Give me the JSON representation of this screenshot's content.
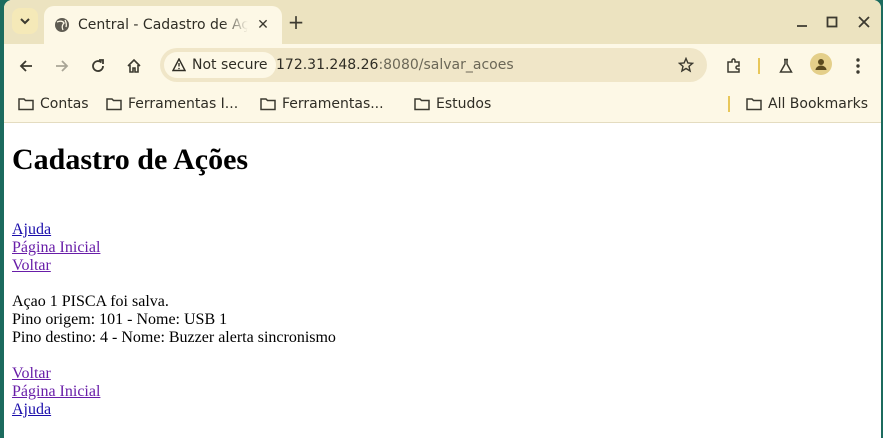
{
  "browser": {
    "tab_title": "Central - Cadastro de Ações",
    "security_label": "Not secure",
    "url_host": "172.31.248.26",
    "url_rest": ":8080/salvar_acoes",
    "bookmarks": [
      "Contas",
      "Ferramentas I...",
      "Ferramentas...",
      "Estudos"
    ],
    "all_bookmarks_label": "All Bookmarks",
    "accent_color": "#ece3c0"
  },
  "page": {
    "title": "Cadastro de Ações",
    "top_links": [
      "Ajuda",
      "Página Inicial",
      "Voltar"
    ],
    "messages": [
      "Açao 1 PISCA foi salva.",
      "Pino origem: 101 - Nome: USB 1",
      "Pino destino: 4 - Nome: Buzzer alerta sincronismo"
    ],
    "bottom_links": [
      "Voltar",
      "Página Inicial",
      "Ajuda"
    ]
  }
}
